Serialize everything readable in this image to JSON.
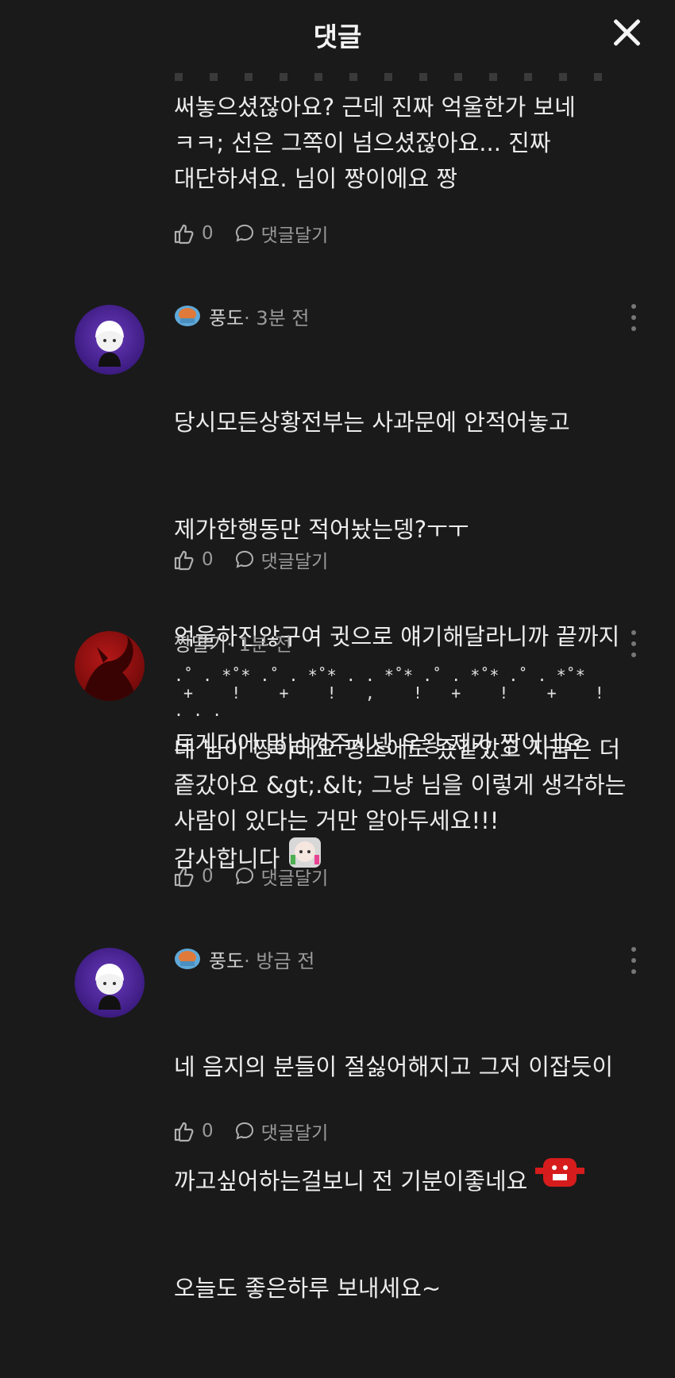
{
  "header": {
    "title": "댓글",
    "close_icon": "close-icon"
  },
  "actions": {
    "like_icon": "thumbs-up-icon",
    "reply_icon": "speech-bubble-icon"
  },
  "comments": [
    {
      "text": "써놓으셨잖아요? 근데 진짜 억울한가 보네\nㅋㅋ; 선은 그쪽이 넘으셨잖아요... 진짜\n대단하셔요. 님이 짱이에요 짱",
      "likes": "0",
      "reply_label": "댓글달기"
    },
    {
      "username": "풍도",
      "time": "· 3분 전",
      "text_lines": [
        "당시모든상황전부는 사과문에 안적어놓고",
        "제가한행동만 적어놨는뎅?ㅜㅜ",
        "억울하진않구여 귓으로 얘기해달라니까 끝까지",
        "트게더에 말남겨주시넹 우왕 제가 짱이네요"
      ],
      "text_last": "감사합니다",
      "likes": "0",
      "reply_label": "댓글달기"
    },
    {
      "username": "짱딸기",
      "time": "· 1분 전",
      "deco_line1": ".˚ . *˚* .˚ . *˚* . . *˚* .˚ . *˚* .˚ . *˚*",
      "deco_line2": " +    !    +    !   ,    !   +    !    +    !",
      "deco_line3": ". . .",
      "text": "네 님이 짱이에요 평소에도 죴같았고 지금은 더\n좉갔아요 &gt;.&lt; 그냥 님을 이렇게 생각하는\n사람이 있다는 거만 알아두세요!!!",
      "likes": "0",
      "reply_label": "댓글달기"
    },
    {
      "username": "풍도",
      "time": "· 방금 전",
      "line1": "네 음지의 분들이 절싫어해지고 그저 이잡듯이",
      "line2": "까고싶어하는걸보니 전 기분이좋네요",
      "line3": "오늘도 좋은하루 보내세요~",
      "likes": "0",
      "reply_label": "댓글달기"
    }
  ]
}
